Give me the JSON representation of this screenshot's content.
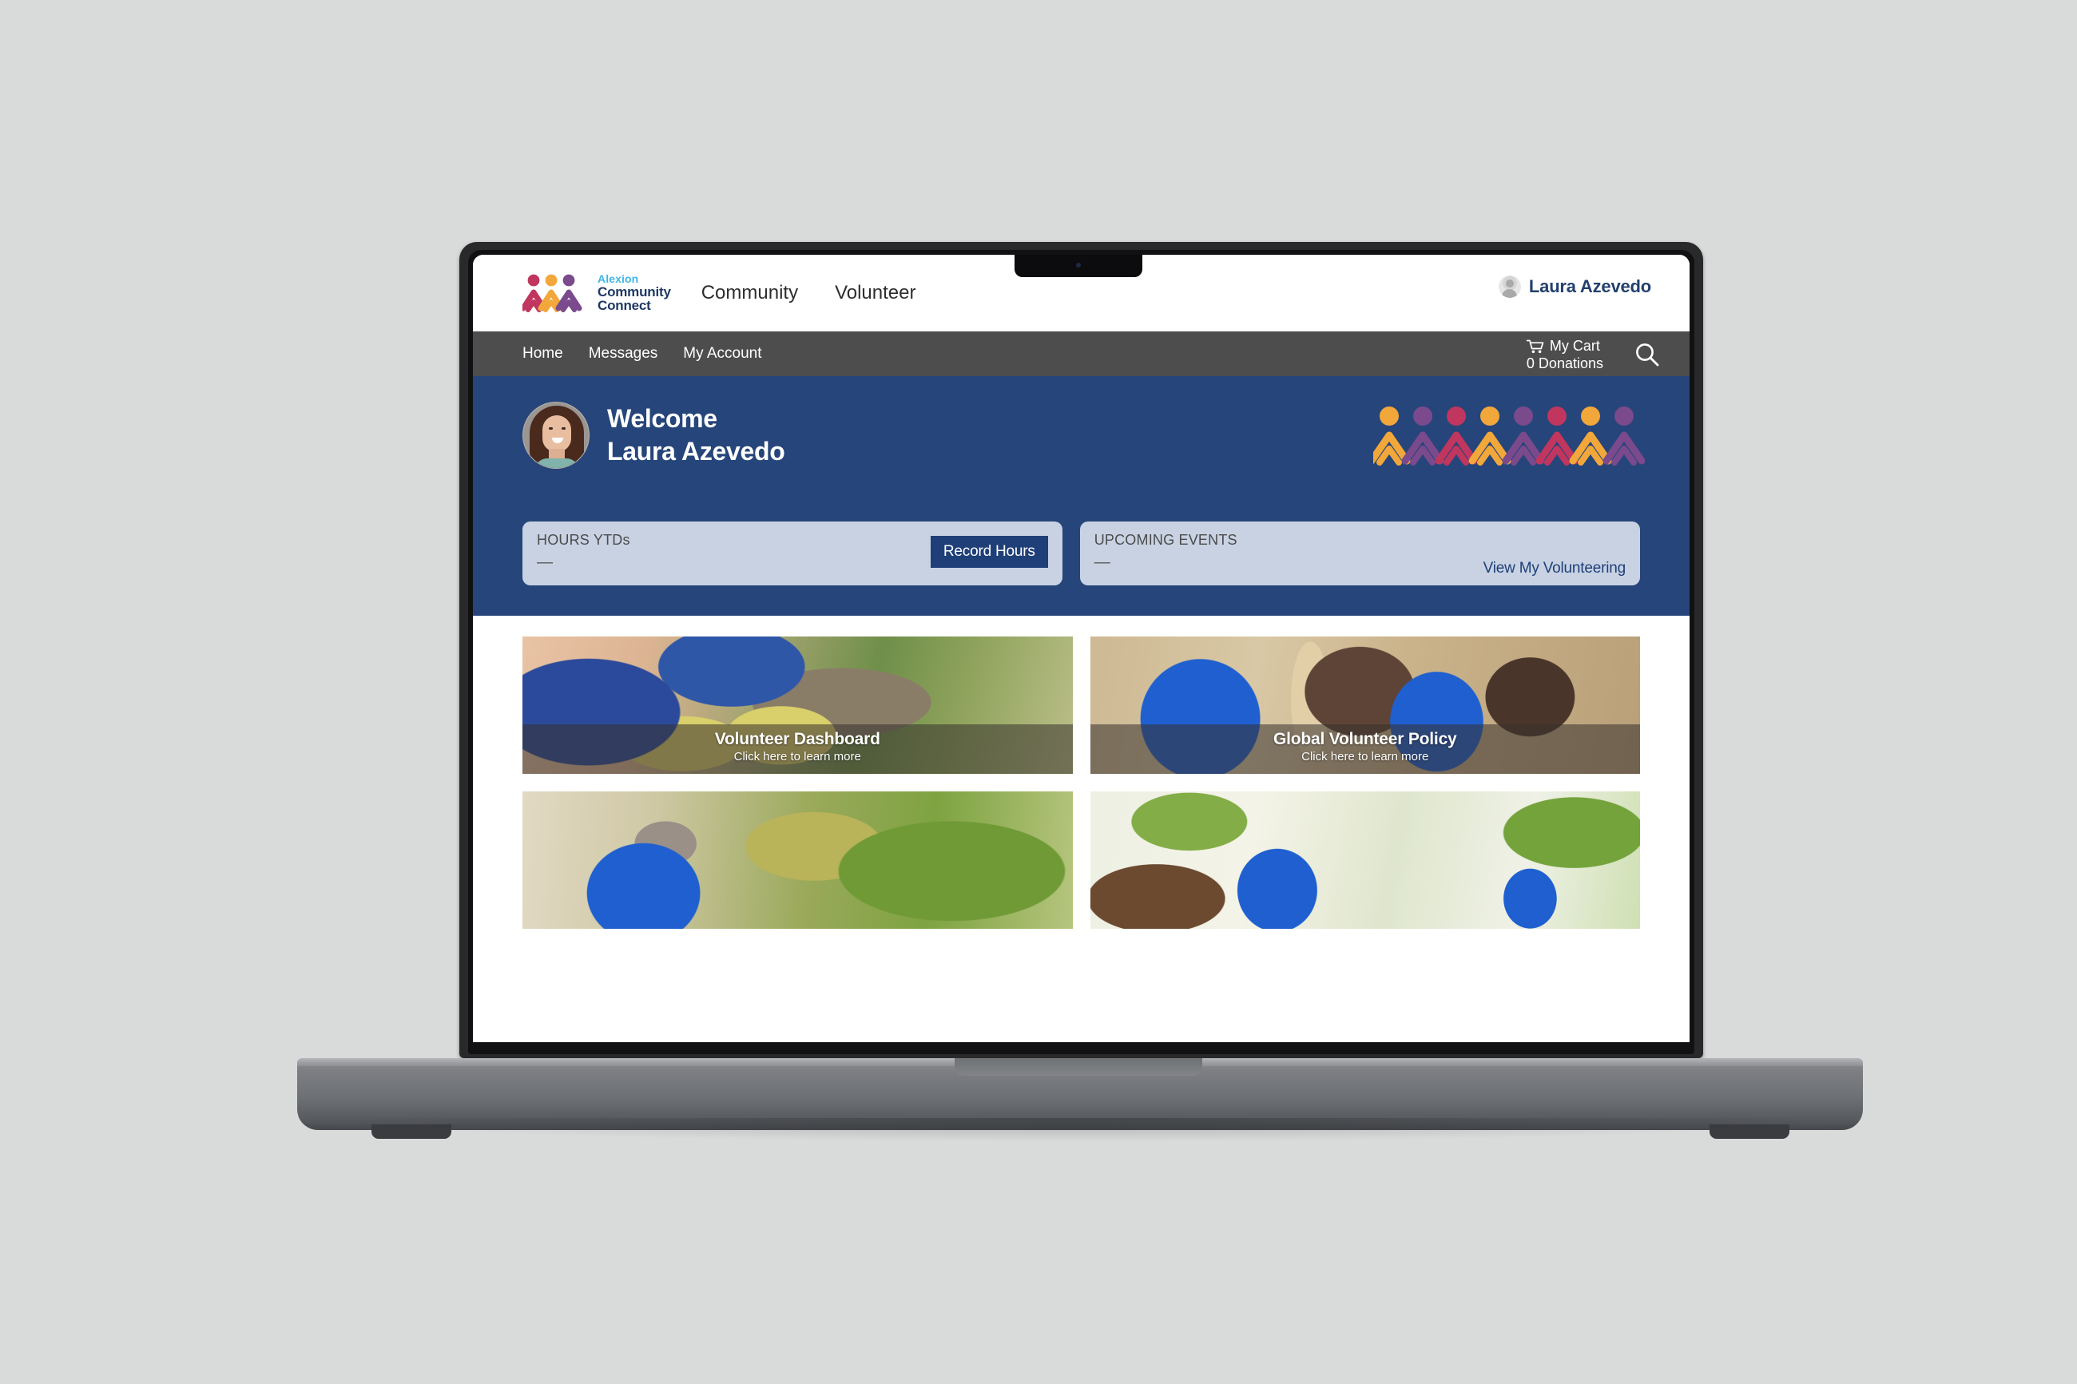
{
  "device": {
    "type": "laptop-mockup",
    "background_color": "#d9dada"
  },
  "brand": {
    "logo_line1": "Alexion",
    "logo_line2": "Community",
    "logo_line3": "Connect",
    "accent_light_blue": "#41b6e6",
    "accent_navy": "#1f3864",
    "figure_colors": [
      "#c0365e",
      "#f2a73b",
      "#7a4a8c"
    ]
  },
  "topnav": {
    "items": [
      {
        "label": "Community"
      },
      {
        "label": "Volunteer"
      }
    ],
    "user": {
      "name": "Laura Azevedo",
      "avatar": "user-avatar-placeholder"
    }
  },
  "graynav": {
    "background_color": "#4d4d4d",
    "items": [
      {
        "label": "Home"
      },
      {
        "label": "Messages"
      },
      {
        "label": "My Account"
      }
    ],
    "cart": {
      "title": "My Cart",
      "count_label": "0 Donations",
      "icon": "shopping-cart-icon"
    },
    "search": {
      "icon": "search-icon"
    }
  },
  "hero": {
    "background_color": "#26457a",
    "greeting": "Welcome",
    "user_name": "Laura Azevedo",
    "pattern_colors": [
      "#f2a73b",
      "#7a4a8c",
      "#c0365e"
    ],
    "pattern_count": 8
  },
  "stat_cards": [
    {
      "label": "HOURS YTDs",
      "value": "—",
      "action_label": "Record Hours",
      "action_type": "button",
      "action_color": "#1f3f78"
    },
    {
      "label": "UPCOMING EVENTS",
      "value": "—",
      "action_label": "View My Volunteering",
      "action_type": "link",
      "action_color": "#1f3f78"
    }
  ],
  "tiles": [
    {
      "title": "Volunteer Dashboard",
      "subtitle": "Click here to learn more",
      "image": "volunteers-with-gloves-outdoors"
    },
    {
      "title": "Global Volunteer Policy",
      "subtitle": "Click here to learn more",
      "image": "volunteers-indoors-with-pole"
    },
    {
      "title": "",
      "subtitle": "",
      "image": "volunteer-man-blue-shirt-garden"
    },
    {
      "title": "",
      "subtitle": "",
      "image": "volunteers-outdoors-sunlit"
    }
  ]
}
